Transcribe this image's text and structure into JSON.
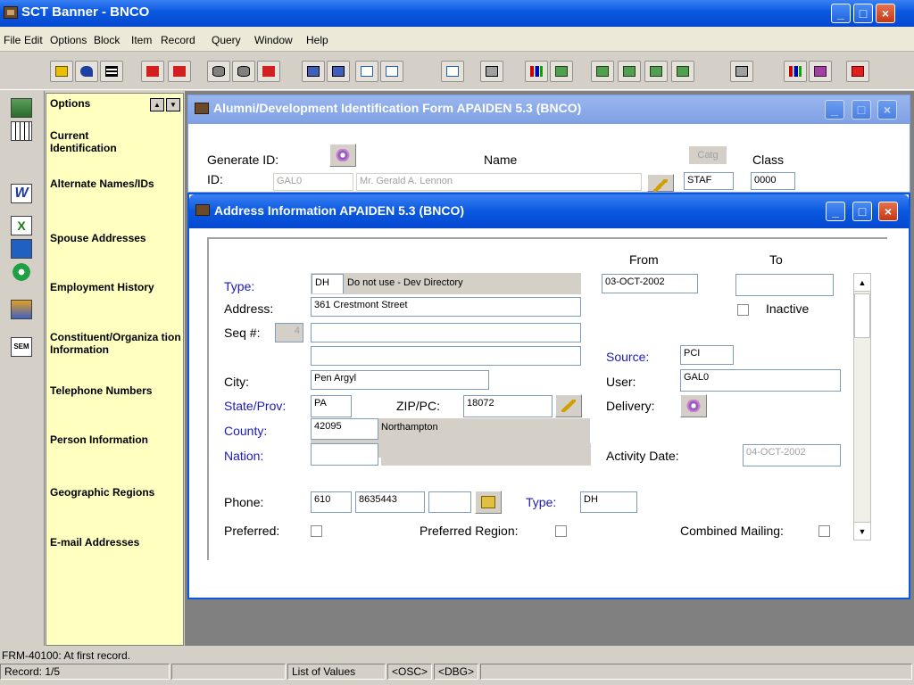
{
  "app": {
    "title": "SCT Banner - BNCO",
    "minimize": "_",
    "maximize": "□",
    "close": "×"
  },
  "menu": [
    "File",
    "Edit",
    "Options",
    "Block",
    "Item",
    "Record",
    "Query",
    "Window",
    "Help"
  ],
  "toolbar_icons": [
    "save-icon",
    "rollback-icon",
    "select-icon",
    "insert-record-icon",
    "remove-record-icon",
    "enter-query-icon",
    "execute-query-icon",
    "cancel-query-icon",
    "previous-block-icon",
    "next-block-icon",
    "print-icon",
    "export-icon",
    "chart-icon",
    "dynamic-help-icon",
    "first-record-icon",
    "last-record-icon",
    "previous-record-icon",
    "next-record-icon",
    "calendar-icon",
    "bookshelf-icon",
    "exit-icon"
  ],
  "options_panel": {
    "header": "Options",
    "up": "▲",
    "down": "▼",
    "items": [
      "Current Identification",
      "Alternate Names/IDs",
      "Spouse Addresses",
      "Employment History",
      "Constituent/Organiza tion Information",
      "Telephone Numbers",
      "Person Information",
      "Geographic Regions",
      "E-mail Addresses"
    ]
  },
  "id_form": {
    "title": "Alumni/Development Identification Form  APAIDEN  5.3  (BNCO)",
    "generate_id_label": "Generate ID:",
    "name_label": "Name",
    "catg_button": "Catg",
    "class_label": "Class",
    "id_label": "ID:",
    "id_value": "GAL0",
    "name_value": "Mr. Gerald A. Lennon",
    "catg_value": "STAF",
    "class_value": "0000"
  },
  "address_form": {
    "title": "Address Information  APAIDEN  5.3  (BNCO)",
    "from_label": "From",
    "to_label": "To",
    "type_label": "Type:",
    "type_code": "DH",
    "type_desc": "Do not use - Dev Directory",
    "from_date": "03-OCT-2002",
    "to_date": "",
    "inactive_label": "Inactive",
    "address_label": "Address:",
    "address_line1": "361 Crestmont Street",
    "address_line2": "",
    "address_line3": "",
    "seq_label": "Seq #:",
    "seq_value": "4",
    "source_label": "Source:",
    "source_value": "PCI",
    "city_label": "City:",
    "city_value": "Pen Argyl",
    "user_label": "User:",
    "user_value": "GAL0",
    "state_label": "State/Prov:",
    "state_value": "PA",
    "zip_label": "ZIP/PC:",
    "zip_value": "18072",
    "delivery_label": "Delivery:",
    "county_label": "County:",
    "county_code": "42095",
    "county_name": "Northampton",
    "nation_label": "Nation:",
    "nation_code": "",
    "activity_label": "Activity Date:",
    "activity_value": "04-OCT-2002",
    "phone_label": "Phone:",
    "phone_area": "610",
    "phone_number": "8635443",
    "phone_ext": "",
    "phone_type_label": "Type:",
    "phone_type_value": "DH",
    "preferred_label": "Preferred:",
    "preferred_region_label": "Preferred Region:",
    "combined_label": "Combined Mailing:"
  },
  "statusbar": {
    "message": "FRM-40100: At first record.",
    "record": "Record: 1/5",
    "lov": "List of Values",
    "osc": "<OSC>",
    "dbg": "<DBG>"
  }
}
